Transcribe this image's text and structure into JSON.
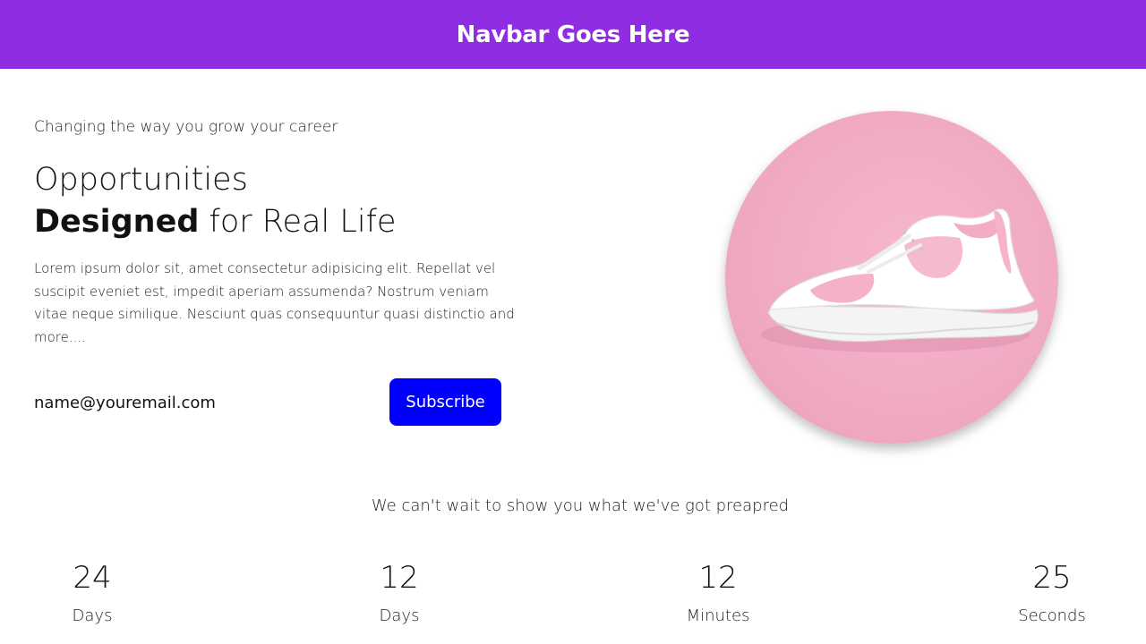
{
  "navbar": {
    "title": "Navbar Goes Here",
    "color": "#8e2de2"
  },
  "hero": {
    "tagline": "Changing the way you grow your career",
    "headline_line1": "Opportunities",
    "headline_bold": "Designed",
    "headline_rest": " for Real Life",
    "description": "Lorem ipsum dolor sit, amet consectetur adipisicing elit. Repellat vel suscipit eveniet est, impedit aperiam assumenda? Nostrum veniam vitae neque similique. Nesciunt quas consequuntur quasi distinctio and more....",
    "email_placeholder": "name@youremail.com",
    "subscribe_label": "Subscribe",
    "subscribe_color": "#0000ff"
  },
  "countdown": {
    "text": "We can't wait to show you what we've got preapred",
    "items": [
      {
        "value": "24",
        "label": "Days"
      },
      {
        "value": "12",
        "label": "Days"
      },
      {
        "value": "12",
        "label": "Minutes"
      },
      {
        "value": "25",
        "label": "Seconds"
      }
    ]
  }
}
